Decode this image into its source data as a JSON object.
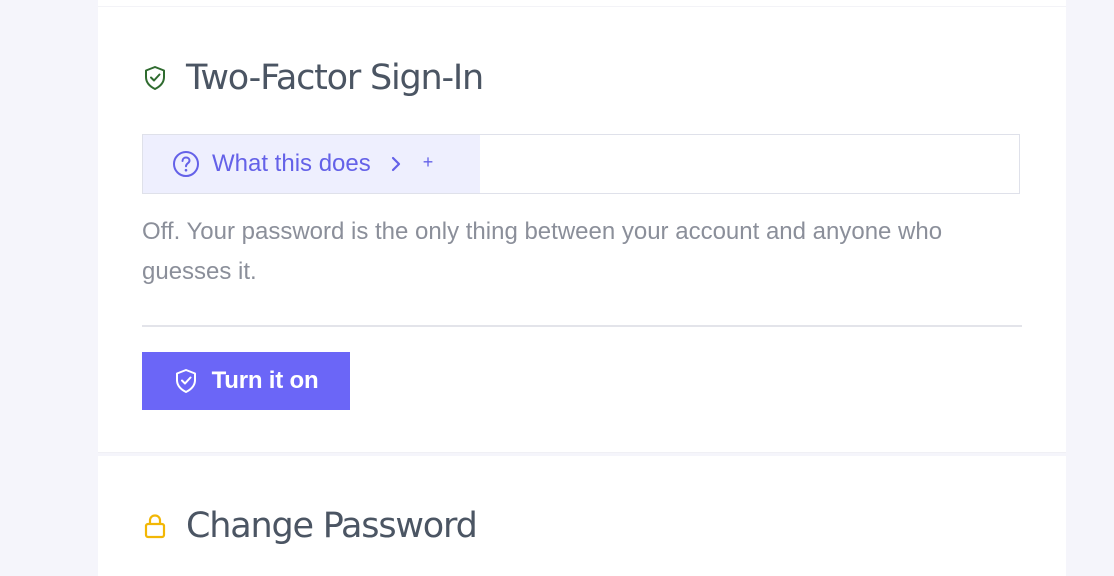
{
  "two_factor": {
    "title": "Two-Factor Sign-In",
    "title_icon": "shield-check-icon",
    "disclosure": {
      "label": "What this does",
      "icon": "help-circle-icon",
      "chevron": "chevron-right-icon",
      "expand_symbol": "+"
    },
    "status_text": "Off. Your password is the only thing between your account and anyone who guesses it.",
    "enable_button": {
      "label": "Turn it on",
      "icon": "shield-check-icon"
    }
  },
  "change_password": {
    "title": "Change Password",
    "title_icon": "lock-icon"
  },
  "colors": {
    "accent": "#6b66f7",
    "accent_text": "#6461e8",
    "accent_bg": "#eeeffe",
    "success": "#2f6b2f",
    "warning": "#f2b705",
    "heading": "#4b5563",
    "muted_text": "#8b8f9a",
    "page_bg": "#f5f5fb"
  }
}
